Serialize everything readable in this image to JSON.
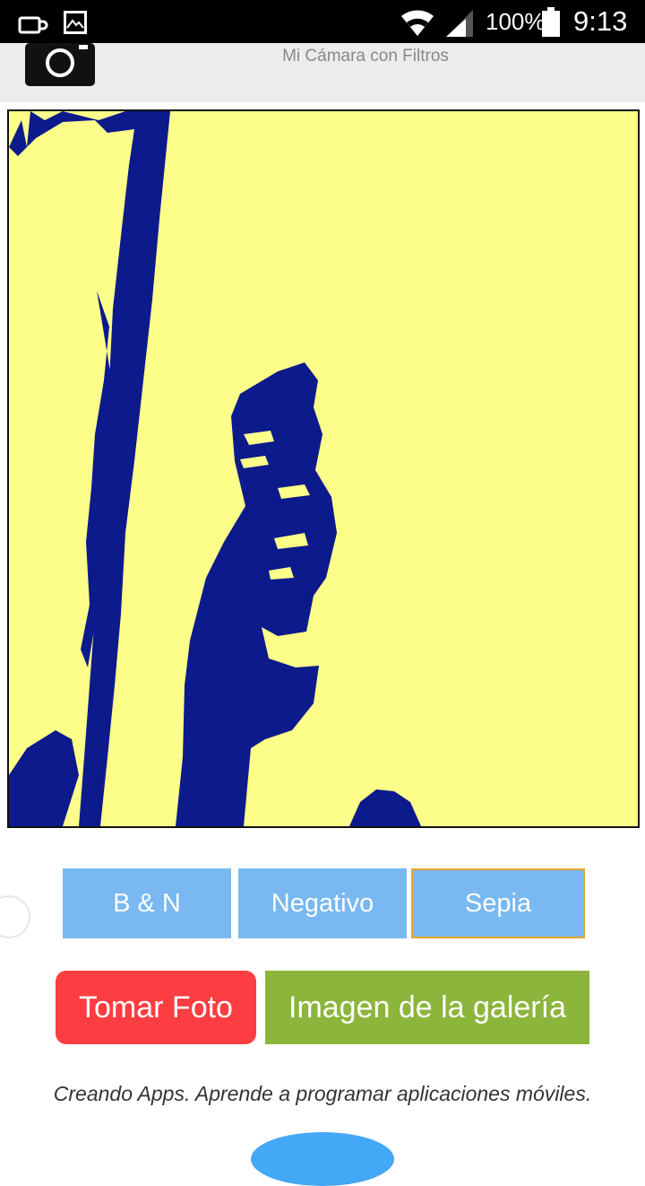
{
  "status_bar": {
    "battery_percent": "100%",
    "time": "9:13",
    "icons": [
      "cup-icon",
      "image-icon",
      "wifi-icon",
      "cell-signal-icon",
      "battery-icon"
    ]
  },
  "app_bar": {
    "title": "Mi Cámara con Filtros",
    "logo_icon": "camera-icon"
  },
  "photo": {
    "filter_applied": "Sepia",
    "colors": {
      "background": "#fdfd8a",
      "figure": "#0c1a8c"
    }
  },
  "filters": {
    "options": [
      "B & N",
      "Negativo",
      "Sepia"
    ],
    "selected": "Sepia"
  },
  "actions": {
    "take_photo_label": "Tomar Foto",
    "gallery_label": "Imagen de la galería",
    "colors": {
      "take_photo": "#fc3d41",
      "gallery": "#8cb53c"
    }
  },
  "footer": {
    "text": "Creando Apps. Aprende a programar aplicaciones móviles."
  }
}
